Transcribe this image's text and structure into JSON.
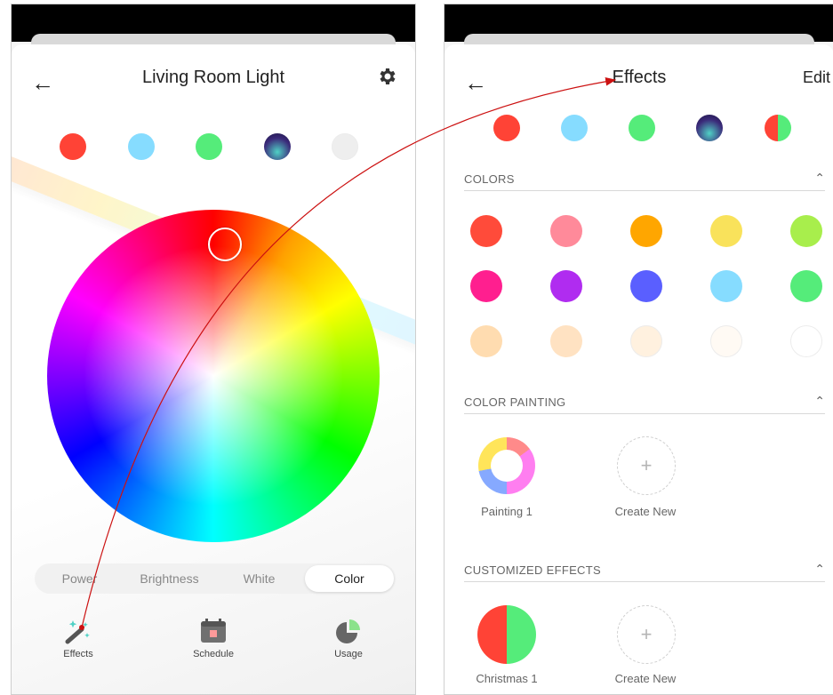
{
  "left": {
    "title": "Living Room Light",
    "back_icon": "arrow-left-icon",
    "settings_icon": "gear-icon",
    "presets": [
      {
        "color": "#ff4336"
      },
      {
        "color": "#86dcff"
      },
      {
        "color": "#55ec7a"
      },
      {
        "color": "aurora"
      },
      {
        "color": "#eeeeee"
      }
    ],
    "tabs_bar": {
      "options": [
        "Power",
        "Brightness",
        "White",
        "Color"
      ],
      "selected": "Color"
    },
    "bottom_tabs": [
      {
        "label": "Effects",
        "icon": "magic-wand-icon"
      },
      {
        "label": "Schedule",
        "icon": "calendar-icon"
      },
      {
        "label": "Usage",
        "icon": "pie-chart-icon"
      }
    ]
  },
  "right": {
    "title": "Effects",
    "edit_label": "Edit",
    "back_icon": "arrow-left-icon",
    "recent": [
      {
        "color": "#ff4336"
      },
      {
        "color": "#86dcff"
      },
      {
        "color": "#55ec7a"
      },
      {
        "color": "aurora"
      },
      {
        "color": "split-red-green"
      }
    ],
    "colors_header": "COLORS",
    "colors": [
      "#ff4b3a",
      "#ff8a9a",
      "#ffa600",
      "#f9e25b",
      "#a8ee4c",
      "#ff1f8f",
      "#b02cf0",
      "#5a5fff",
      "#86dcff",
      "#55ec7a",
      "#ffdcb0",
      "#ffe2c2",
      "#fff1df",
      "#fffaf4",
      "#ffffff"
    ],
    "painting_header": "COLOR PAINTING",
    "painting_item": "Painting 1",
    "painting_create": "Create New",
    "custom_header": "CUSTOMIZED EFFECTS",
    "custom_item": "Christmas 1",
    "custom_create": "Create New",
    "collapse_icon": "chevron-up-icon"
  },
  "annotation": {
    "color": "#cc1111"
  }
}
